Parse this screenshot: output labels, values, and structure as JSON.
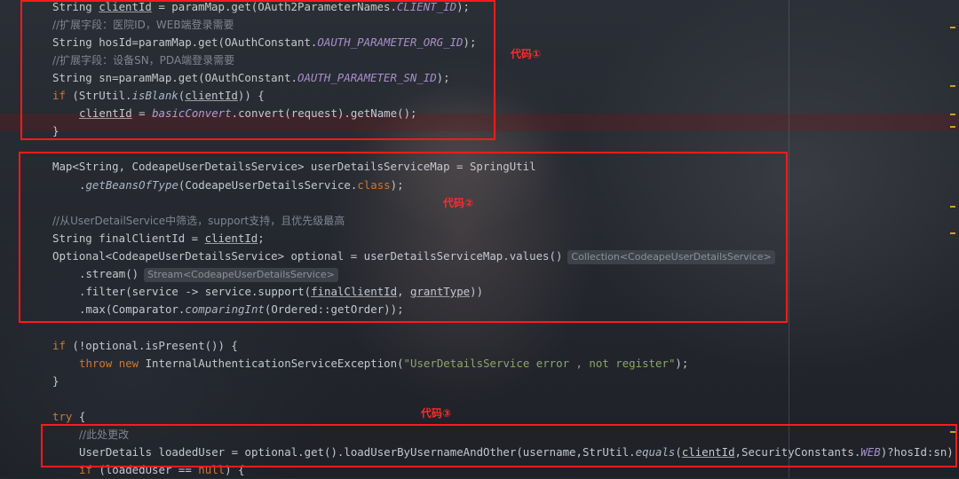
{
  "lines": [
    {
      "id": "l1",
      "segments": [
        {
          "t": "String "
        },
        {
          "t": "clientId",
          "c": "und"
        },
        {
          "t": " = paramMap.get(OAuth2ParameterNames."
        },
        {
          "t": "CLIENT_ID",
          "c": "st"
        },
        {
          "t": ");"
        }
      ]
    },
    {
      "id": "l2",
      "segments": [
        {
          "t": "//扩展字段：医院ID，WEB端登录需要",
          "c": "cm"
        }
      ]
    },
    {
      "id": "l3",
      "segments": [
        {
          "t": "String hosId=paramMap.get(OAuthConstant."
        },
        {
          "t": "OAUTH_PARAMETER_ORG_ID",
          "c": "st"
        },
        {
          "t": ");"
        }
      ]
    },
    {
      "id": "l4",
      "segments": [
        {
          "t": "//扩展字段：设备SN，PDA端登录需要",
          "c": "cm"
        }
      ]
    },
    {
      "id": "l5",
      "segments": [
        {
          "t": "String sn=paramMap.get(OAuthConstant."
        },
        {
          "t": "OAUTH_PARAMETER_SN_ID",
          "c": "st"
        },
        {
          "t": ");"
        }
      ]
    },
    {
      "id": "l6",
      "segments": [
        {
          "t": "if",
          "c": "kw"
        },
        {
          "t": " (StrUtil."
        },
        {
          "t": "isBlank",
          "c": "it"
        },
        {
          "t": "("
        },
        {
          "t": "clientId",
          "c": "und"
        },
        {
          "t": ")) {"
        }
      ]
    },
    {
      "id": "l7",
      "segments": [
        {
          "t": "clientId",
          "c": "und"
        },
        {
          "t": " = "
        },
        {
          "t": "basicConvert",
          "c": "pu"
        },
        {
          "t": ".convert(request).getName();"
        }
      ]
    },
    {
      "id": "l8",
      "segments": [
        {
          "t": "}"
        }
      ]
    },
    {
      "id": "l9",
      "segments": [
        {
          "t": "Map<String, CodeapeUserDetailsService> userDetailsServiceMap = SpringUtil"
        }
      ]
    },
    {
      "id": "l10",
      "segments": [
        {
          "t": "."
        },
        {
          "t": "getBeansOfType",
          "c": "it"
        },
        {
          "t": "(CodeapeUserDetailsService."
        },
        {
          "t": "class",
          "c": "kw"
        },
        {
          "t": ");"
        }
      ]
    },
    {
      "id": "l11",
      "segments": [
        {
          "t": "//从UserDetailService中筛选，support支持，且优先级最高",
          "c": "cm"
        }
      ]
    },
    {
      "id": "l12",
      "segments": [
        {
          "t": "String finalClientId = "
        },
        {
          "t": "clientId",
          "c": "und"
        },
        {
          "t": ";"
        }
      ]
    },
    {
      "id": "l13",
      "segments": [
        {
          "t": "Optional<CodeapeUserDetailsService> optional = userDetailsServiceMap.values()"
        }
      ],
      "hint": "Collection<CodeapeUserDetailsService>"
    },
    {
      "id": "l14",
      "segments": [
        {
          "t": ".stream()"
        }
      ],
      "hint": "Stream<CodeapeUserDetailsService>"
    },
    {
      "id": "l15",
      "segments": [
        {
          "t": ".filter(service -> service.support("
        },
        {
          "t": "finalClientId",
          "c": "und"
        },
        {
          "t": ", "
        },
        {
          "t": "grantType",
          "c": "und"
        },
        {
          "t": "))"
        }
      ]
    },
    {
      "id": "l16",
      "segments": [
        {
          "t": ".max(Comparator."
        },
        {
          "t": "comparingInt",
          "c": "it"
        },
        {
          "t": "(Ordered::getOrder));"
        }
      ]
    },
    {
      "id": "l17",
      "segments": [
        {
          "t": "if",
          "c": "kw"
        },
        {
          "t": " (!optional.isPresent()) {"
        }
      ]
    },
    {
      "id": "l18",
      "segments": [
        {
          "t": "throw new",
          "c": "kw"
        },
        {
          "t": " InternalAuthenticationServiceException("
        },
        {
          "t": "\"UserDetailsService error , not register\"",
          "c": "str"
        },
        {
          "t": ");"
        }
      ]
    },
    {
      "id": "l19",
      "segments": [
        {
          "t": "}"
        }
      ]
    },
    {
      "id": "l20",
      "segments": [
        {
          "t": "try",
          "c": "kw"
        },
        {
          "t": " {"
        }
      ]
    },
    {
      "id": "l21",
      "segments": [
        {
          "t": "//此处更改",
          "c": "cm"
        }
      ]
    },
    {
      "id": "l22",
      "segments": [
        {
          "t": "UserDetails loadedUser = optional.get().loadUserByUsernameAndOther(username,StrUtil."
        },
        {
          "t": "equals",
          "c": "it"
        },
        {
          "t": "("
        },
        {
          "t": "clientId",
          "c": "und"
        },
        {
          "t": ",SecurityConstants."
        },
        {
          "t": "WEB",
          "c": "st"
        },
        {
          "t": ")?hosId:sn)"
        }
      ]
    },
    {
      "id": "l23",
      "segments": [
        {
          "t": "if",
          "c": "kw"
        },
        {
          "t": " (loadedUser == "
        },
        {
          "t": "null",
          "c": "kw"
        },
        {
          "t": ") {"
        }
      ]
    }
  ],
  "annotations": {
    "code1": "代码①",
    "code2": "代码②",
    "code3": "代码③"
  },
  "colors": {
    "box": "#ff1a1a",
    "keyword": "#cc7832",
    "string": "#8ba66e"
  }
}
